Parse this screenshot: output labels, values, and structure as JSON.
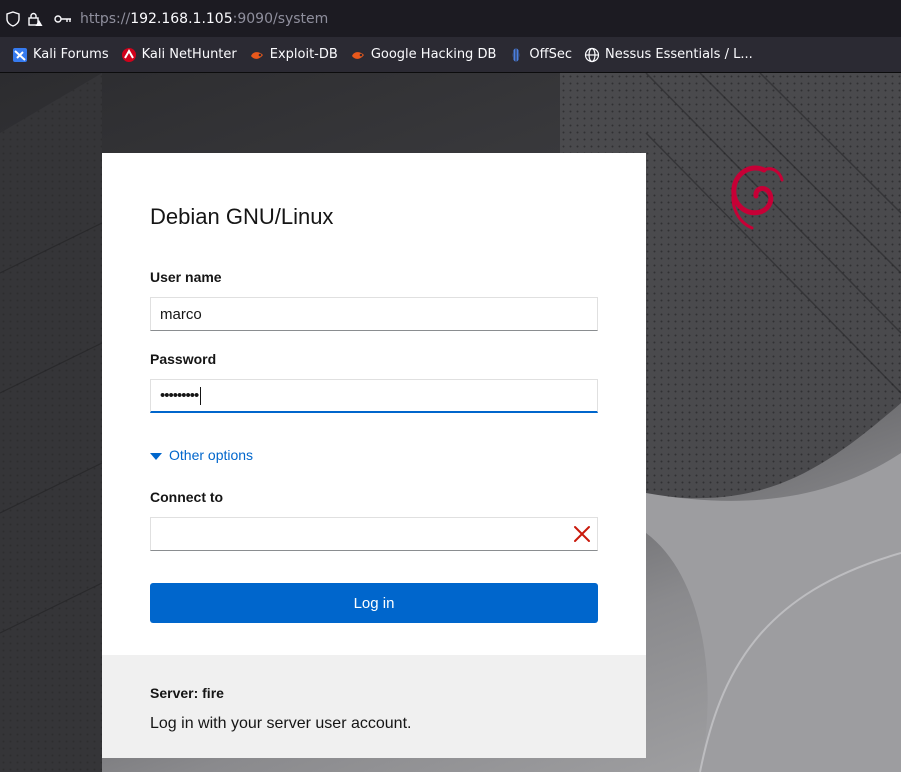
{
  "browser": {
    "url_prefix": "https://",
    "url_host": "192.168.1.105",
    "url_suffix": ":9090/system",
    "icons": [
      "shield-icon",
      "lock-warning-icon",
      "key-icon"
    ]
  },
  "bookmarks": [
    {
      "label": "Kali Forums",
      "icon": "kali-forums-icon"
    },
    {
      "label": "Kali NetHunter",
      "icon": "kali-nethunter-icon"
    },
    {
      "label": "Exploit-DB",
      "icon": "exploit-db-icon"
    },
    {
      "label": "Google Hacking DB",
      "icon": "ghdb-icon"
    },
    {
      "label": "OffSec",
      "icon": "offsec-icon"
    },
    {
      "label": "Nessus Essentials / L...",
      "icon": "globe-icon"
    }
  ],
  "login": {
    "title": "Debian GNU/Linux",
    "username_label": "User name",
    "username_value": "marco",
    "password_label": "Password",
    "password_value": "•••••••••",
    "other_options": "Other options",
    "connect_label": "Connect to",
    "connect_value": "",
    "login_button": "Log in",
    "server_label": "Server: fire",
    "hint": "Log in with your server user account."
  },
  "colors": {
    "accent": "#0066cc",
    "debian_red": "#c70036",
    "clear_icon": "#c9190b"
  }
}
